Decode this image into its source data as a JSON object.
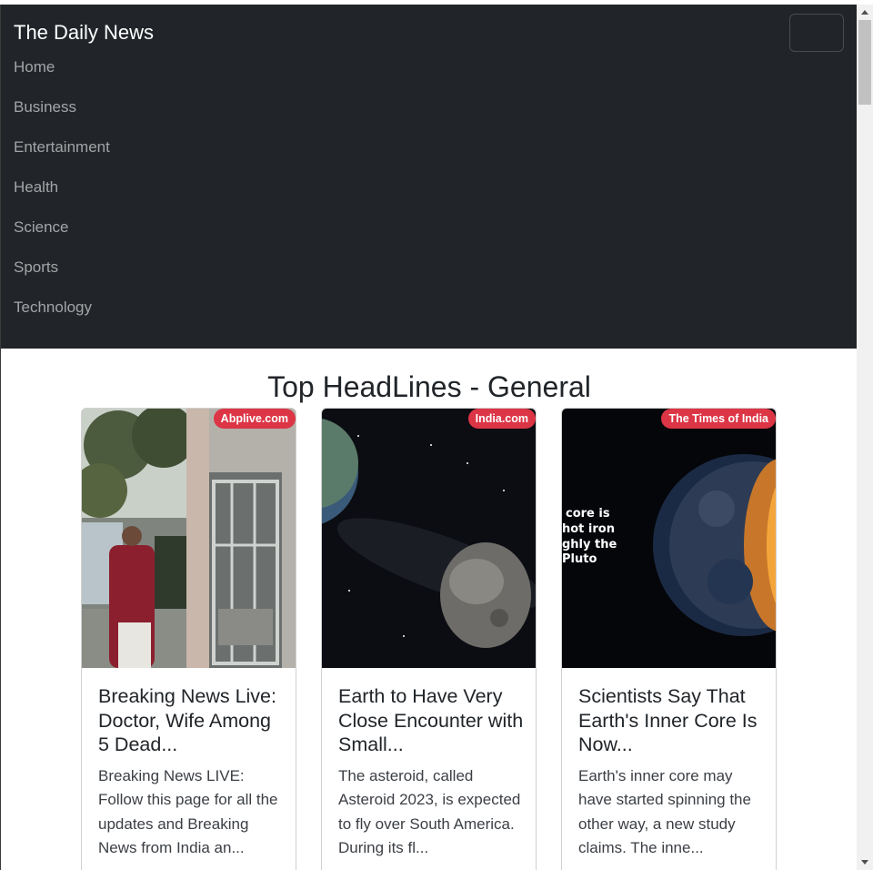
{
  "navbar": {
    "brand": "The Daily News",
    "items": [
      {
        "label": "Home"
      },
      {
        "label": "Business"
      },
      {
        "label": "Entertainment"
      },
      {
        "label": "Health"
      },
      {
        "label": "Science"
      },
      {
        "label": "Sports"
      },
      {
        "label": "Technology"
      }
    ]
  },
  "main": {
    "heading": "Top HeadLines - General",
    "cards": [
      {
        "source": "Abplive.com",
        "title": "Breaking News Live: Doctor, Wife Among 5 Dead...",
        "description": "Breaking News LIVE: Follow this page for all the updates and Breaking News from India an...",
        "image_icon": "street-photo"
      },
      {
        "source": "India.com",
        "title": "Earth to Have Very Close Encounter with Small...",
        "description": "The asteroid, called Asteroid 2023, is expected to fly over South America. During its fl...",
        "image_icon": "asteroid-photo"
      },
      {
        "source": "The Times of India",
        "title": "Scientists Say That Earth's Inner Core Is Now...",
        "description": "Earth's inner core may have started spinning the other way, a new study claims. The inne...",
        "image_icon": "earth-photo",
        "image_overlay_lines": [
          "core is",
          "hot iron",
          "ghly the",
          "Pluto"
        ]
      }
    ]
  },
  "colors": {
    "navbar_bg": "#212529",
    "badge_bg": "#dc3545"
  }
}
